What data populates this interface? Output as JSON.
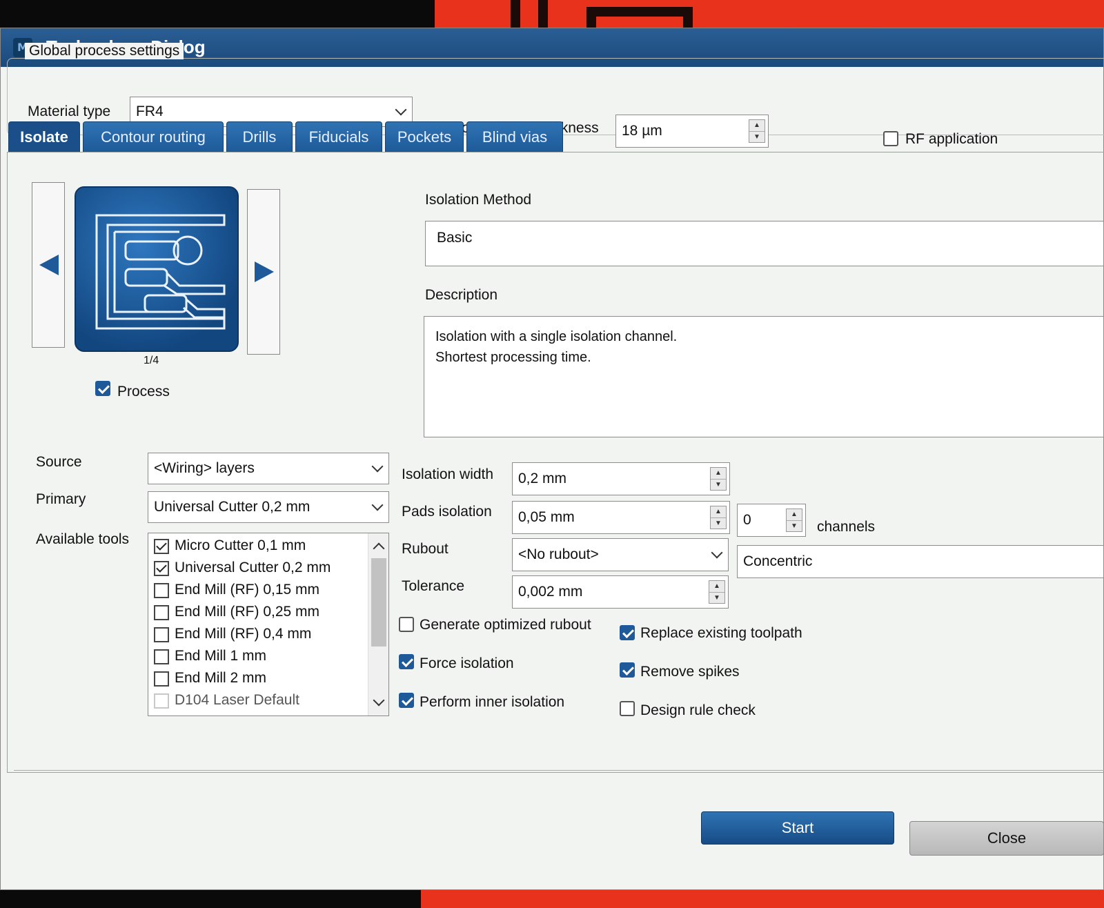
{
  "window": {
    "title": "Technology Dialog",
    "icon": "app-icon"
  },
  "global": {
    "group_title": "Global process settings",
    "material_label": "Material type",
    "material_value": "FR4",
    "copper_label": "Copper layer thickness",
    "copper_value": "18 µm",
    "rf_label": "RF application",
    "rf_checked": false
  },
  "tabs": [
    {
      "label": "Isolate",
      "active": true
    },
    {
      "label": "Contour routing"
    },
    {
      "label": "Drills"
    },
    {
      "label": "Fiducials"
    },
    {
      "label": "Pockets"
    },
    {
      "label": "Blind vias"
    }
  ],
  "preview": {
    "page_indicator": "1/4",
    "process_label": "Process",
    "process_checked": true
  },
  "isolation": {
    "method_label": "Isolation Method",
    "method_value": "Basic",
    "description_label": "Description",
    "description_line1": "Isolation with a single isolation channel.",
    "description_line2": "Shortest processing time."
  },
  "params": {
    "source_label": "Source",
    "source_value": "<Wiring> layers",
    "primary_label": "Primary",
    "primary_value": "Universal Cutter 0,2 mm",
    "available_tools_label": "Available tools",
    "isolation_width_label": "Isolation width",
    "isolation_width_value": "0,2 mm",
    "pads_isolation_label": "Pads isolation",
    "pads_isolation_value": "0,05 mm",
    "channels_value": "0",
    "channels_label": "channels",
    "rubout_label": "Rubout",
    "rubout_value": "<No rubout>",
    "rubout_mode_value": "Concentric",
    "tolerance_label": "Tolerance",
    "tolerance_value": "0,002 mm"
  },
  "tools": [
    {
      "label": "Micro Cutter 0,1 mm",
      "checked": true
    },
    {
      "label": "Universal Cutter 0,2 mm",
      "checked": true
    },
    {
      "label": "End Mill (RF) 0,15 mm",
      "checked": false
    },
    {
      "label": "End Mill (RF) 0,25 mm",
      "checked": false
    },
    {
      "label": "End Mill (RF) 0,4 mm",
      "checked": false
    },
    {
      "label": "End Mill 1 mm",
      "checked": false
    },
    {
      "label": "End Mill 2 mm",
      "checked": false
    },
    {
      "label": "D104 Laser Default",
      "checked": false,
      "disabled": true
    }
  ],
  "options": {
    "generate_optimized_rubout": {
      "label": "Generate optimized rubout",
      "checked": false
    },
    "force_isolation": {
      "label": "Force isolation",
      "checked": true
    },
    "perform_inner_isolation": {
      "label": "Perform inner isolation",
      "checked": true
    },
    "replace_existing_toolpath": {
      "label": "Replace existing toolpath",
      "checked": true
    },
    "remove_spikes": {
      "label": "Remove spikes",
      "checked": true
    },
    "design_rule_check": {
      "label": "Design rule check",
      "checked": false
    }
  },
  "buttons": {
    "start": "Start",
    "close": "Close"
  },
  "colors": {
    "accent": "#1e5a9a",
    "titlebar": "#1c4a7c",
    "background_pcb": "#e8321c"
  }
}
